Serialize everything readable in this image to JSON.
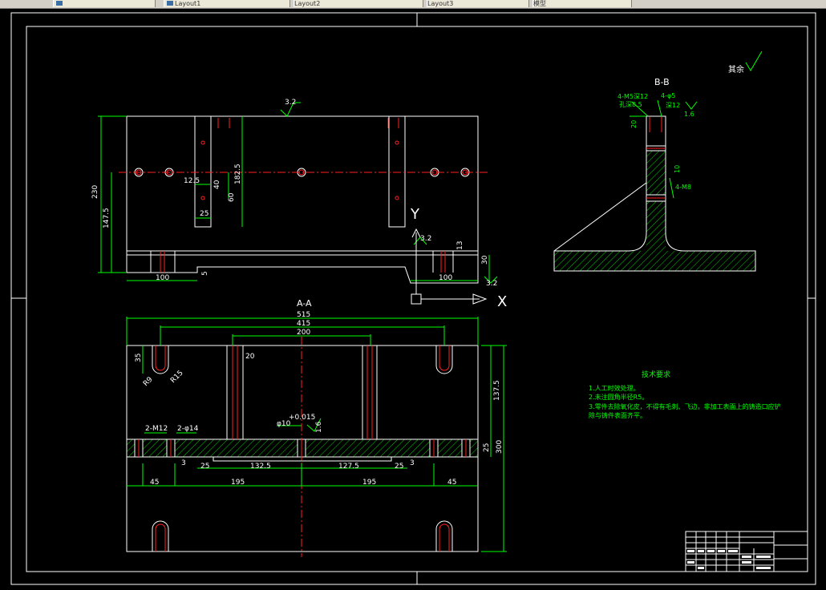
{
  "tabs": [
    {
      "label": ""
    },
    {
      "label": "Layout1"
    },
    {
      "label": "Layout2"
    },
    {
      "label": "Layout3"
    },
    {
      "label": "模型"
    }
  ],
  "views": {
    "section_bb": "B-B",
    "section_aa": "A-A",
    "axis_x": "X",
    "axis_y": "Y"
  },
  "roughness": {
    "rest": "其余",
    "top": "3.2",
    "mid": "3.2",
    "right": "3.2",
    "bb": "1.6",
    "aa": "1.6"
  },
  "dims_top": {
    "h230": "230",
    "h147_5": "147.5",
    "h182_5": "182.5",
    "h60": "60",
    "h40": "40",
    "w12_5": "12.5",
    "w25": "25",
    "w100_left": "100",
    "w100_right": "100",
    "h5": "5",
    "h30": "30",
    "h13": "13"
  },
  "dims_bb": {
    "m5": "4-M5深12",
    "hole": "孔深8.5",
    "phi5": "4-φ5",
    "deep12": "深12",
    "d20": "20",
    "m8": "4-M8",
    "d10": "10"
  },
  "dims_aa": {
    "w515": "515",
    "w415": "415",
    "w200": "200",
    "h35": "35",
    "w20": "20",
    "r9": "R9",
    "r15": "R15",
    "m12": "2-M12",
    "phi14": "2-φ14",
    "phi10": "φ10",
    "tol": "+0.015",
    "d3a": "3",
    "d25a": "25",
    "d132_5": "132.5",
    "d127_5": "127.5",
    "d25b": "25",
    "d3b": "3",
    "d45a": "45",
    "d195a": "195",
    "d195b": "195",
    "d45b": "45",
    "h137_5": "137.5",
    "h25": "25",
    "h300": "300"
  },
  "notes": {
    "title": "技术要求",
    "items": [
      "1.人工时效处理。",
      "2.未注圆角半径R5。",
      "3.零件去除氧化皮，不得有毛刺、飞边，非加工表面上的铸造口应铲",
      "除与铸件表面齐平。"
    ]
  }
}
